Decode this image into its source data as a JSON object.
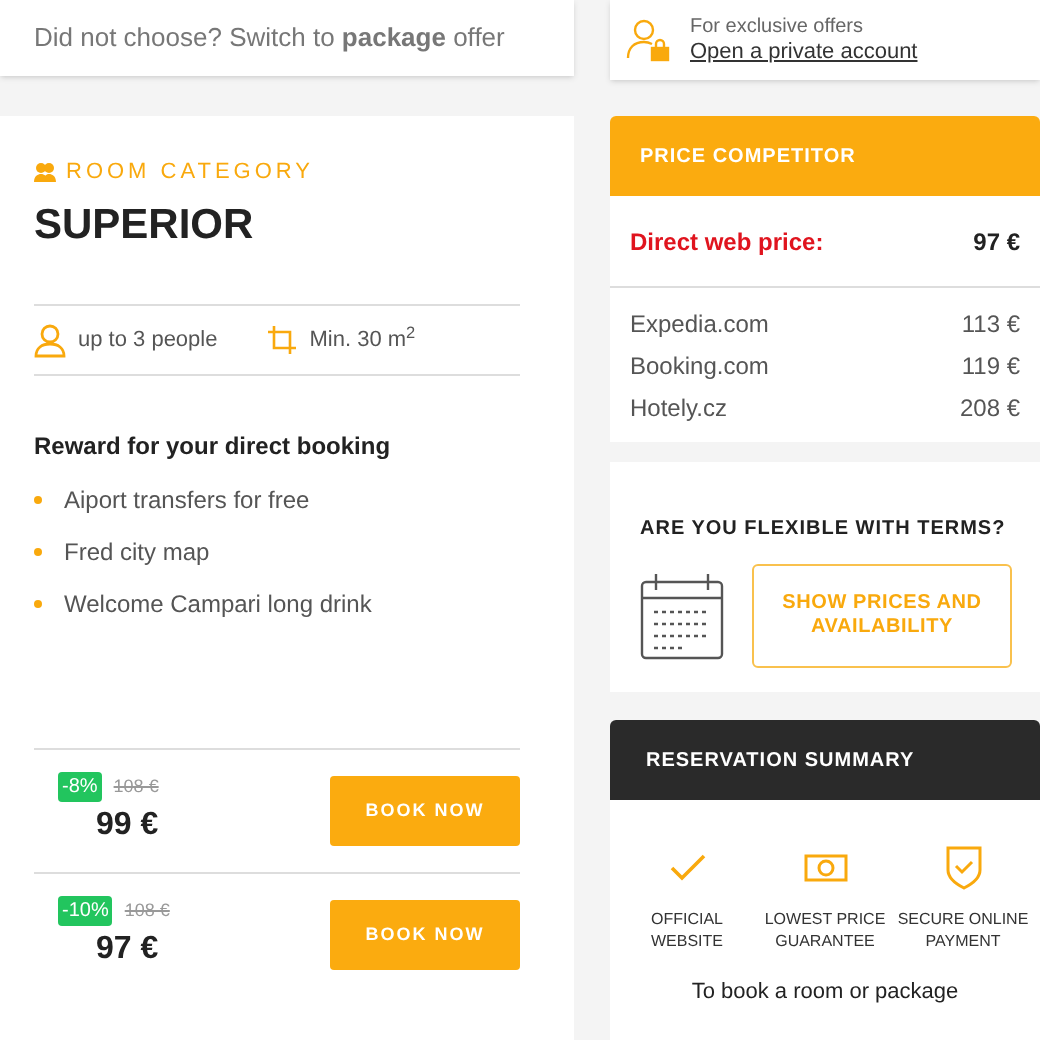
{
  "package_prompt": "Did not choose? Switch to **package** offer",
  "room": {
    "category_label": "ROOM CATEGORY",
    "name": "SUPERIOR",
    "features": [
      {
        "kind": "people",
        "text": "up to 3 people"
      },
      {
        "kind": "area",
        "text": "Min. 30 m$^{2}$"
      }
    ],
    "reward_title": "Reward for your direct booking",
    "rewards": [
      "Aiport transfers for free",
      "Fred city map",
      "Welcome Campari long drink"
    ],
    "offers": [
      {
        "discount": "-8%",
        "old_price": "108 €",
        "price": "99 €",
        "button": "BOOK NOW"
      },
      {
        "discount": "-10%",
        "old_price": "108 €",
        "price": "97 €",
        "button": "BOOK NOW"
      }
    ]
  },
  "account": {
    "caption": "For exclusive offers",
    "link": "Open a private account"
  },
  "price_competitor": {
    "title": "PRICE COMPETITOR",
    "direct_label": "Direct web price:",
    "direct_price": "97 €",
    "rows": [
      {
        "site": "Expedia.com",
        "price": "113 €"
      },
      {
        "site": "Booking.com",
        "price": "119 €"
      },
      {
        "site": "Hotely.cz",
        "price": "208 €"
      }
    ]
  },
  "flexible": {
    "title": "ARE YOU FLEXIBLE WITH TERMS?",
    "button": "SHOW PRICES AND AVAILABILITY"
  },
  "summary": {
    "title": "RESERVATION SUMMARY",
    "benefits": [
      {
        "kind": "check",
        "text": "OFFICIAL WEBSITE"
      },
      {
        "kind": "money",
        "text": "LOWEST PRICE GUARANTEE"
      },
      {
        "kind": "shield",
        "text": "SECURE ONLINE PAYMENT"
      }
    ],
    "footer": "To book a room or package"
  }
}
